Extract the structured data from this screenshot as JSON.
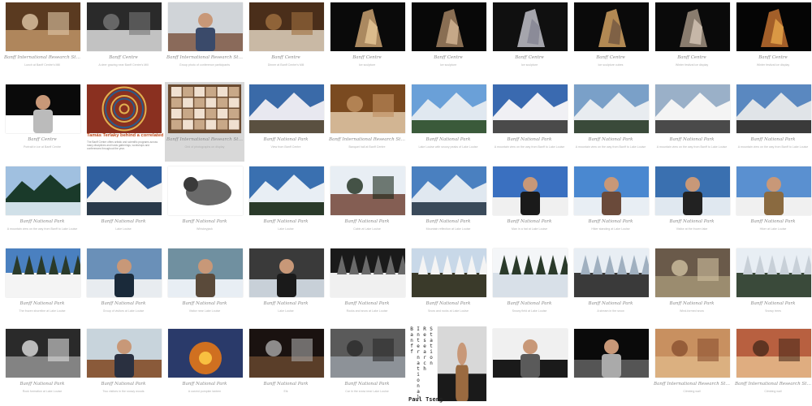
{
  "colors": {
    "background": "#ffffff",
    "caption": "#8a8a8a",
    "promo_accent": "#c24a1a"
  },
  "rows": [
    [
      {
        "title": "Banff International Research Station",
        "desc": "Lunch at Banff Centre's Mill",
        "img": "dining-hall"
      },
      {
        "title": "Banff Centre",
        "desc": "A deer grazing near Banff Centre's Mill",
        "img": "deer"
      },
      {
        "title": "Banff International Research Station",
        "desc": "Group photo of conference participants",
        "img": "group-photo"
      },
      {
        "title": "Banff Centre",
        "desc": "Dinner at Banff Centre's Mill",
        "img": "dinner-table"
      },
      {
        "title": "Banff Centre",
        "desc": "Ice sculpture",
        "img": "ice-sculpture"
      },
      {
        "title": "Banff Centre",
        "desc": "Ice sculpture",
        "img": "ice-sculpture-2"
      },
      {
        "title": "Banff Centre",
        "desc": "Ice sculpture",
        "img": "ice-spiral"
      },
      {
        "title": "Banff Centre",
        "desc": "Ice sculpture cubes",
        "img": "ice-cubes"
      },
      {
        "title": "Banff Centre",
        "desc": "Winter festival ice display",
        "img": "ice-arch"
      },
      {
        "title": "Banff Centre",
        "desc": "Winter festival ice display",
        "img": "ice-night"
      }
    ],
    [
      {
        "title": "Banff Centre",
        "desc": "Portrait in ice at Banff Centre",
        "img": "bw-portrait"
      },
      {
        "promo": true,
        "head": "Tamás Terlaky behind a correlated SDDoor!",
        "body": "The Banff Centre offers artistic and scientific programs across many disciplines and hosts gatherings, workshops and conferences throughout the year.",
        "img": "mosaic"
      },
      {
        "title": "Banff International Research Station",
        "desc": "Grid of photographs on display",
        "img": "photo-grid",
        "gray": true
      },
      {
        "title": "Banff National Park",
        "desc": "View from Banff Centre",
        "img": "mountain-1"
      },
      {
        "title": "Banff International Research Station",
        "desc": "Banquet hall at Banff Centre",
        "img": "banquet"
      },
      {
        "title": "Banff National Park",
        "desc": "Lake Louise with snowy peaks of Lake Louise",
        "img": "mountain-2"
      },
      {
        "title": "Banff National Park",
        "desc": "A mountain view on the way from Banff to Lake Louise",
        "img": "mountain-3"
      },
      {
        "title": "Banff National Park",
        "desc": "A mountain view on the way from Banff to Lake Louise",
        "img": "mountain-4"
      },
      {
        "title": "Banff National Park",
        "desc": "A mountain view on the way from Banff to Lake Louise",
        "img": "mountain-5"
      },
      {
        "title": "Banff National Park",
        "desc": "A mountain view on the way from Banff to Lake Louise",
        "img": "mountain-6"
      }
    ],
    [
      {
        "title": "Banff National Park",
        "desc": "A mountain view on the way from Banff to Lake Louise",
        "img": "forest-lake"
      },
      {
        "title": "Banff National Park",
        "desc": "Lake Louise",
        "img": "snow-peaks"
      },
      {
        "title": "Banff National Park",
        "desc": "Whiskeyjack",
        "img": "bird"
      },
      {
        "title": "Banff National Park",
        "desc": "Lake Louise",
        "img": "mountain-7"
      },
      {
        "title": "Banff National Park",
        "desc": "Cabin at Lake Louise",
        "img": "cabin"
      },
      {
        "title": "Banff National Park",
        "desc": "Mountain reflection at Lake Louise",
        "img": "reflection"
      },
      {
        "title": "Banff National Park",
        "desc": "Man in a hat at Lake Louise",
        "img": "man-hat"
      },
      {
        "title": "Banff National Park",
        "desc": "Hiker standing at Lake Louise",
        "img": "man-standing"
      },
      {
        "title": "Banff National Park",
        "desc": "Visitor at the frozen lake",
        "img": "man-lake"
      },
      {
        "title": "Banff National Park",
        "desc": "Hiker at Lake Louise",
        "img": "man-snow"
      }
    ],
    [
      {
        "title": "Banff National Park",
        "desc": "The frozen shoreline at Lake Louise",
        "img": "snow-trees"
      },
      {
        "title": "Banff National Park",
        "desc": "Group of visitors at Lake Louise",
        "img": "group-snow"
      },
      {
        "title": "Banff National Park",
        "desc": "Visitor near Lake Louise",
        "img": "man-jacket"
      },
      {
        "title": "Banff National Park",
        "desc": "Lake Louise",
        "img": "woman-dark"
      },
      {
        "title": "Banff National Park",
        "desc": "Rocks and snow at Lake Louise",
        "img": "snow-rocks"
      },
      {
        "title": "Banff National Park",
        "desc": "Snow and rocks at Lake Louise",
        "img": "snow-forest"
      },
      {
        "title": "Banff National Park",
        "desc": "Snowy field at Lake Louise",
        "img": "snow-field"
      },
      {
        "title": "Banff National Park",
        "desc": "A stream in the snow",
        "img": "stream"
      },
      {
        "title": "Banff National Park",
        "desc": "Wind-formed snow",
        "img": "sand-ripples"
      },
      {
        "title": "Banff National Park",
        "desc": "Snowy trees",
        "img": "snowy-trees"
      }
    ],
    [
      {
        "title": "Banff National Park",
        "desc": "Rock formation at Lake Louise",
        "img": "bw-rocks"
      },
      {
        "title": "Banff National Park",
        "desc": "Two visitors in the snowy woods",
        "img": "two-men"
      },
      {
        "title": "Banff National Park",
        "desc": "A carved pumpkin lantern",
        "img": "pumpkin"
      },
      {
        "title": "Banff National Park",
        "desc": "Elk",
        "img": "elk"
      },
      {
        "title": "Banff National Park",
        "desc": "Car in the snow near Lake Louise",
        "img": "car"
      },
      {
        "vertical": true,
        "cols": [
          "Banff",
          "International",
          "Research",
          "Station"
        ],
        "name": "Paul Tseng",
        "img": "portrait-asian"
      },
      {
        "title": "",
        "desc": "",
        "img": "portrait-bw-1"
      },
      {
        "title": "",
        "desc": "",
        "img": "portrait-bw-2"
      },
      {
        "title": "Banff International Research Station",
        "desc": "Climbing wall",
        "img": "climb-wall"
      },
      {
        "title": "Banff International Research Station",
        "desc": "Climbing wall",
        "img": "climb-wall-2"
      }
    ]
  ]
}
